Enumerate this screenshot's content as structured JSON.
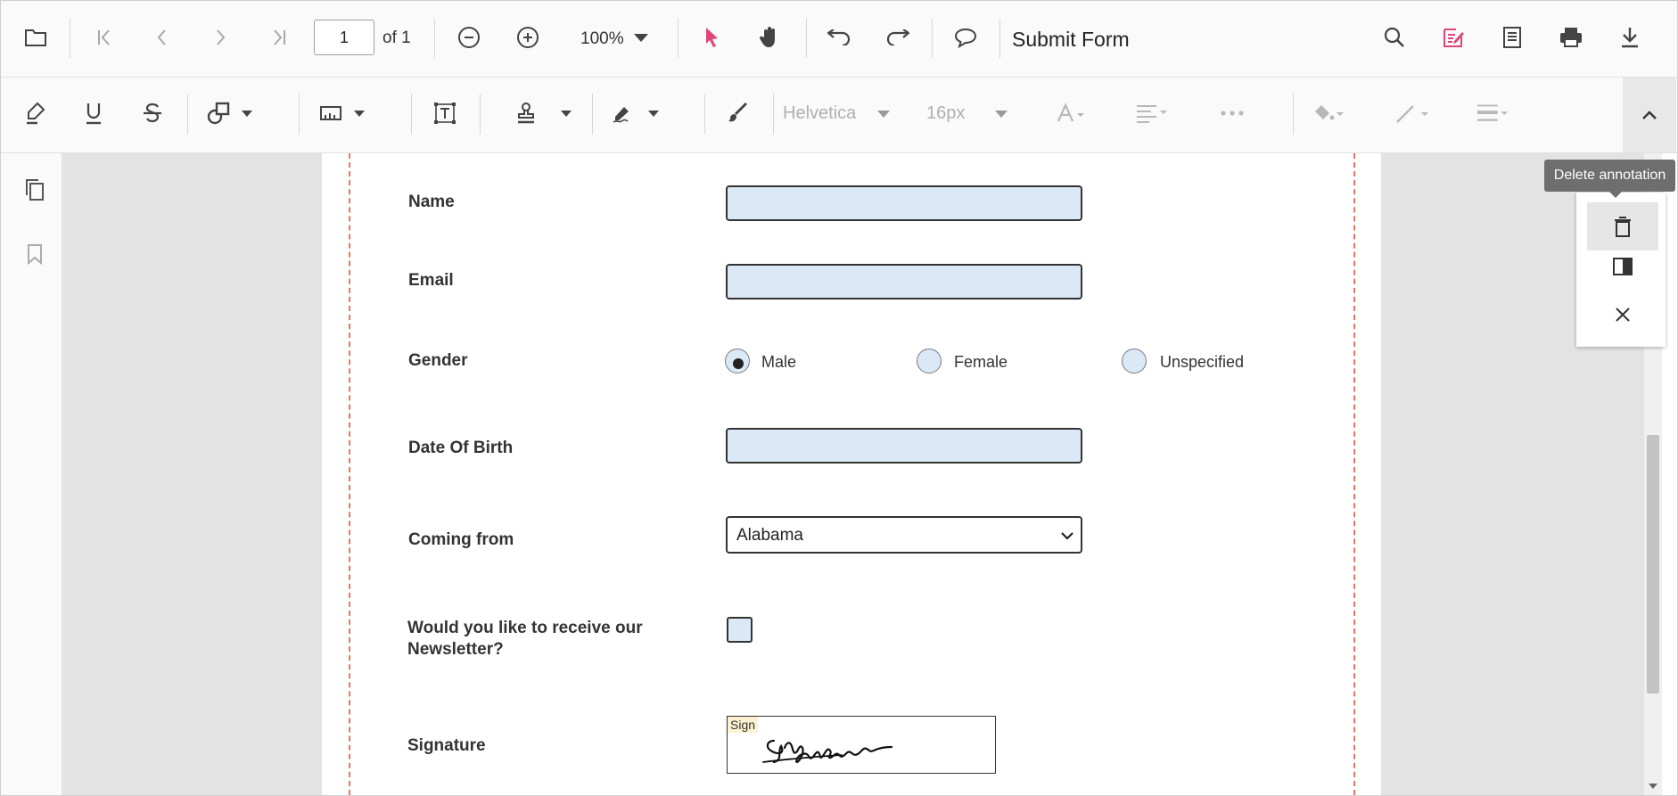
{
  "toolbar": {
    "page_current": "1",
    "page_of": "of 1",
    "zoom": "100%",
    "submit": "Submit Form"
  },
  "annotation_toolbar": {
    "font_family": "Helvetica",
    "font_size": "16px"
  },
  "icons": {
    "open": "folder-icon",
    "first": "first-page-icon",
    "prev": "previous-page-icon",
    "next": "next-page-icon",
    "last": "last-page-icon",
    "zoom_out": "zoom-out-icon",
    "zoom_in": "zoom-in-icon",
    "select": "select-cursor-icon",
    "pan": "pan-hand-icon",
    "undo": "undo-icon",
    "redo": "redo-icon",
    "comment": "comment-icon",
    "search": "search-icon",
    "annotation": "annotation-edit-icon",
    "form": "form-designer-icon",
    "print": "print-icon",
    "download": "download-icon"
  },
  "colors": {
    "accent": "#e0457b",
    "field_bg": "#dbe8f6",
    "page_border": "#e8765e"
  },
  "form": {
    "name_label": "Name",
    "email_label": "Email",
    "gender_label": "Gender",
    "gender_options": [
      "Male",
      "Female",
      "Unspecified"
    ],
    "gender_selected": "Male",
    "dob_label": "Date Of Birth",
    "coming_from_label": "Coming from",
    "coming_from_value": "Alabama",
    "newsletter_label_1": "Would you like to receive our",
    "newsletter_label_2": "Newsletter?",
    "signature_label": "Signature",
    "signature_tag": "Sign"
  },
  "annotation_panel": {
    "tooltip": "Delete annotation"
  }
}
